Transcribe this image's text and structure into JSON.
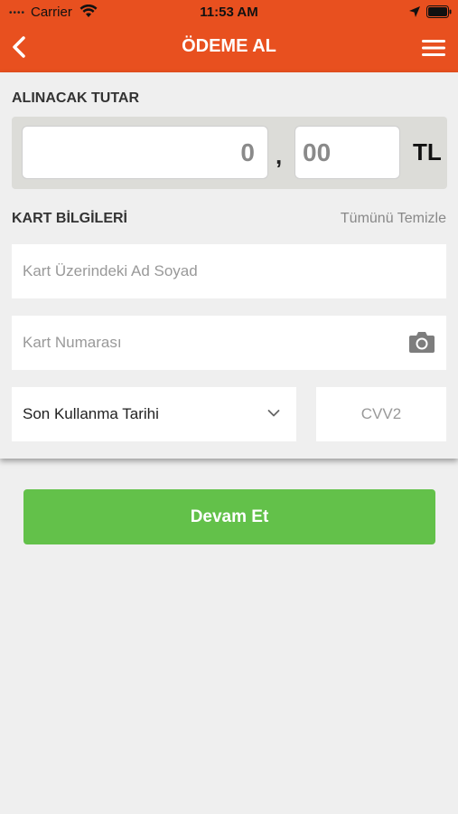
{
  "status_bar": {
    "signal": "••••",
    "carrier": "Carrier",
    "time": "11:53 AM"
  },
  "nav": {
    "title": "ÖDEME AL",
    "back_icon": "chevron-left-icon",
    "menu_icon": "hamburger-menu-icon"
  },
  "amount": {
    "label": "ALINACAK TUTAR",
    "integer_placeholder": "0",
    "separator": ",",
    "decimal_placeholder": "00",
    "currency": "TL"
  },
  "card_info": {
    "label": "KART BİLGİLERİ",
    "clear_all": "Tümünü Temizle",
    "name_placeholder": "Kart Üzerindeki Ad Soyad",
    "number_placeholder": "Kart Numarası",
    "expiry_label": "Son Kullanma Tarihi",
    "cvv_placeholder": "CVV2"
  },
  "actions": {
    "continue": "Devam Et"
  },
  "colors": {
    "header": "#e8501f",
    "primary_button": "#63c14a",
    "background": "#efefef"
  }
}
